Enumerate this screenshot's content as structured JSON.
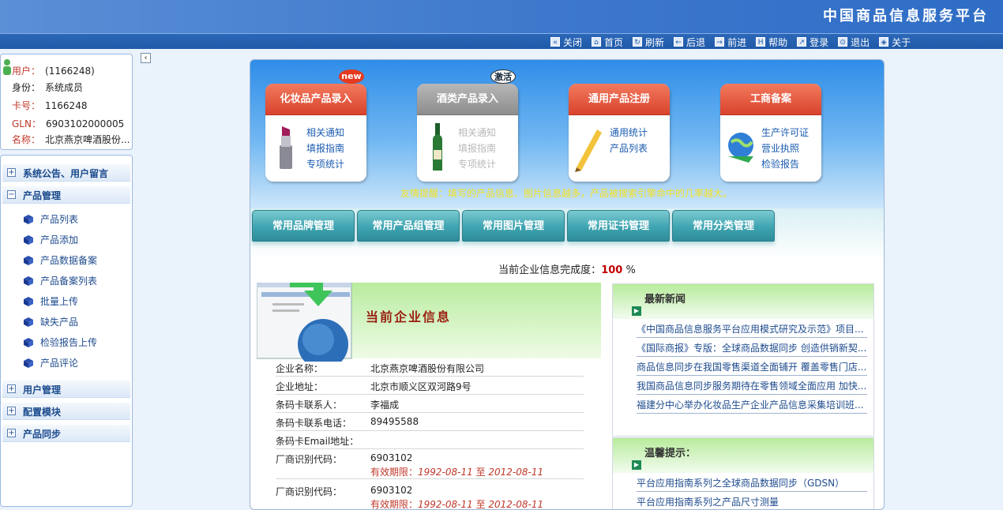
{
  "header": {
    "title": "中国商品信息服务平台"
  },
  "toolbar": {
    "items": [
      {
        "label": "关闭",
        "icon": "close-icon",
        "glyph": "«"
      },
      {
        "label": "首页",
        "icon": "home-icon",
        "glyph": "⌂"
      },
      {
        "label": "刷新",
        "icon": "refresh-icon",
        "glyph": "↻"
      },
      {
        "label": "后退",
        "icon": "back-icon",
        "glyph": "←"
      },
      {
        "label": "前进",
        "icon": "forward-icon",
        "glyph": "→"
      },
      {
        "label": "帮助",
        "icon": "help-icon",
        "glyph": "H"
      },
      {
        "label": "登录",
        "icon": "login-icon",
        "glyph": "↗"
      },
      {
        "label": "退出",
        "icon": "logout-icon",
        "glyph": "⊙"
      },
      {
        "label": "关于",
        "icon": "about-icon",
        "glyph": "◈"
      }
    ]
  },
  "user": {
    "user_label": "用户：",
    "user_value": "(1166248)",
    "role_label": "身份：",
    "role_value": "系统成员",
    "card_label": "卡号：",
    "card_value": "1166248",
    "gln_label": "GLN：",
    "gln_value": "6903102000005",
    "name_label": "名称：",
    "name_value": "北京燕京啤酒股份..."
  },
  "sidebar": {
    "groups": [
      {
        "label": "系统公告、用户留言",
        "toggle": "+"
      },
      {
        "label": "产品管理",
        "toggle": "−"
      },
      {
        "label": "用户管理",
        "toggle": "+"
      },
      {
        "label": "配置模块",
        "toggle": "+"
      },
      {
        "label": "产品同步",
        "toggle": "+"
      }
    ],
    "product_items": [
      "产品列表",
      "产品添加",
      "产品数据备案",
      "产品备案列表",
      "批量上传",
      "缺失产品",
      "检验报告上传",
      "产品评论"
    ]
  },
  "collapse": {
    "glyph": "‹"
  },
  "cards": [
    {
      "title": "化妆品产品录入",
      "badge": "new",
      "links": [
        "相关通知",
        "填报指南",
        "专项统计"
      ]
    },
    {
      "title": "酒类产品录入",
      "badge": "激活",
      "links": [
        "相关通知",
        "填报指南",
        "专项统计"
      ]
    },
    {
      "title": "通用产品注册",
      "badge": "",
      "links": [
        "通用统计",
        "产品列表"
      ]
    },
    {
      "title": "工商备案",
      "badge": "",
      "links": [
        "生产许可证",
        "营业执照",
        "检验报告"
      ]
    }
  ],
  "hint": "友情提醒：填写的产品信息、图片信息越多，产品被搜索引擎命中的几率越大。",
  "tabs": [
    "常用品牌管理",
    "常用产品组管理",
    "常用图片管理",
    "常用证书管理",
    "常用分类管理"
  ],
  "completion": {
    "label": "当前企业信息完成度：",
    "value": "100",
    "unit": "%"
  },
  "company": {
    "banner_title": "当前企业信息",
    "rows": [
      {
        "key": "企业名称：",
        "value": "北京燕京啤酒股份有限公司"
      },
      {
        "key": "企业地址：",
        "value": "北京市顺义区双河路9号"
      },
      {
        "key": "条码卡联系人：",
        "value": "李福成"
      },
      {
        "key": "条码卡联系电话：",
        "value": "89495588"
      },
      {
        "key": "条码卡Email地址：",
        "value": ""
      },
      {
        "key": "厂商识别代码：",
        "value": "6903102"
      },
      {
        "key": "厂商识别代码：",
        "value": "6903102"
      }
    ],
    "validity": [
      {
        "label": "有效期限：",
        "from": "1992-08-11",
        "sep": " 至 ",
        "to": "2012-08-11"
      },
      {
        "label": "有效期限：",
        "from": "1992-08-11",
        "sep": " 至 ",
        "to": "2012-08-11"
      }
    ]
  },
  "news": {
    "title": "最新新闻",
    "items": [
      "《中国商品信息服务平台应用模式研究及示范》项目...",
      "《国际商报》专版：全球商品数据同步 创造供销新契...",
      "商品信息同步在我国零售渠道全面铺开 覆盖零售门店...",
      "我国商品信息同步服务期待在零售领域全面应用 加快...",
      "福建分中心举办化妆品生产企业产品信息采集培训班..."
    ]
  },
  "tips": {
    "title": "温馨提示：",
    "items": [
      "平台应用指南系列之全球商品数据同步（GDSN）",
      "平台应用指南系列之产品尺寸测量"
    ]
  },
  "colors": {
    "header": "#3d78cc",
    "toolbar": "#1f5aa8",
    "card_head": "#e2533a",
    "tab": "#3ea4b1",
    "highlight": "#c00000"
  }
}
